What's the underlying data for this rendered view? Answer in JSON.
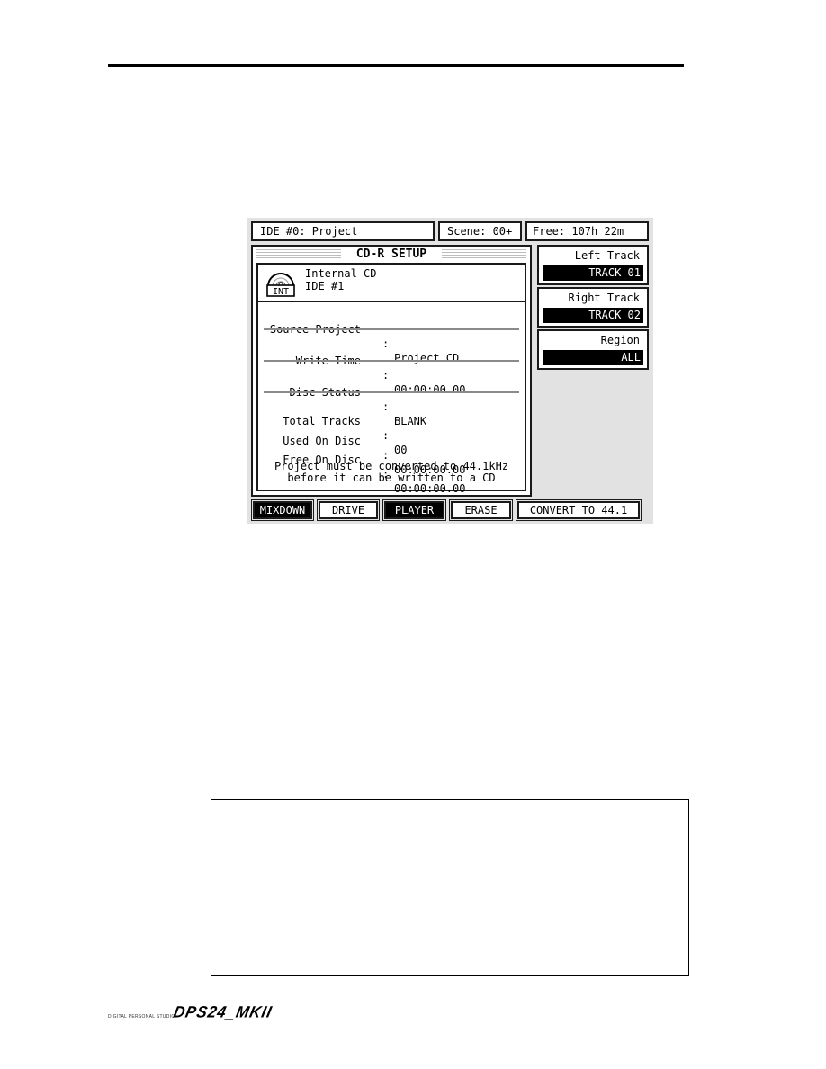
{
  "header": {
    "project": "IDE #0: Project",
    "scene": "Scene: 00+",
    "free": "Free: 107h 22m"
  },
  "panel": {
    "title": "CD-R SETUP",
    "drive": {
      "icon": "cd-drive-icon",
      "icon_label": "INT",
      "name": "Internal CD",
      "id": "IDE #1"
    },
    "rows": [
      {
        "label": "Source Project",
        "value": "Project CD"
      },
      {
        "label": "Write Time",
        "value": "00:00:00.00"
      },
      {
        "label": "Disc Status",
        "value": "BLANK"
      },
      {
        "label": "Total Tracks",
        "value": "00"
      },
      {
        "label": "Used On Disc",
        "value": "00:00:00.00"
      },
      {
        "label": "Free On Disc",
        "value": "00:00:00.00"
      }
    ],
    "separator": ":",
    "note_line1": "Project must be converted to 44.1kHz",
    "note_line2": "before it can be written to a CD"
  },
  "side": {
    "left_track": {
      "label": "Left Track",
      "value": "TRACK 01"
    },
    "right_track": {
      "label": "Right Track",
      "value": "TRACK 02"
    },
    "region": {
      "label": "Region",
      "value": "ALL"
    }
  },
  "softkeys": [
    {
      "label": "MIXDOWN",
      "active": true
    },
    {
      "label": "DRIVE",
      "active": false
    },
    {
      "label": "PLAYER",
      "active": true
    },
    {
      "label": "ERASE",
      "active": false
    },
    {
      "label": "CONVERT TO 44.1",
      "active": false
    }
  ],
  "footer": {
    "subtitle": "DIGITAL PERSONAL STUDIO",
    "logo": "DPS24_MKII"
  }
}
